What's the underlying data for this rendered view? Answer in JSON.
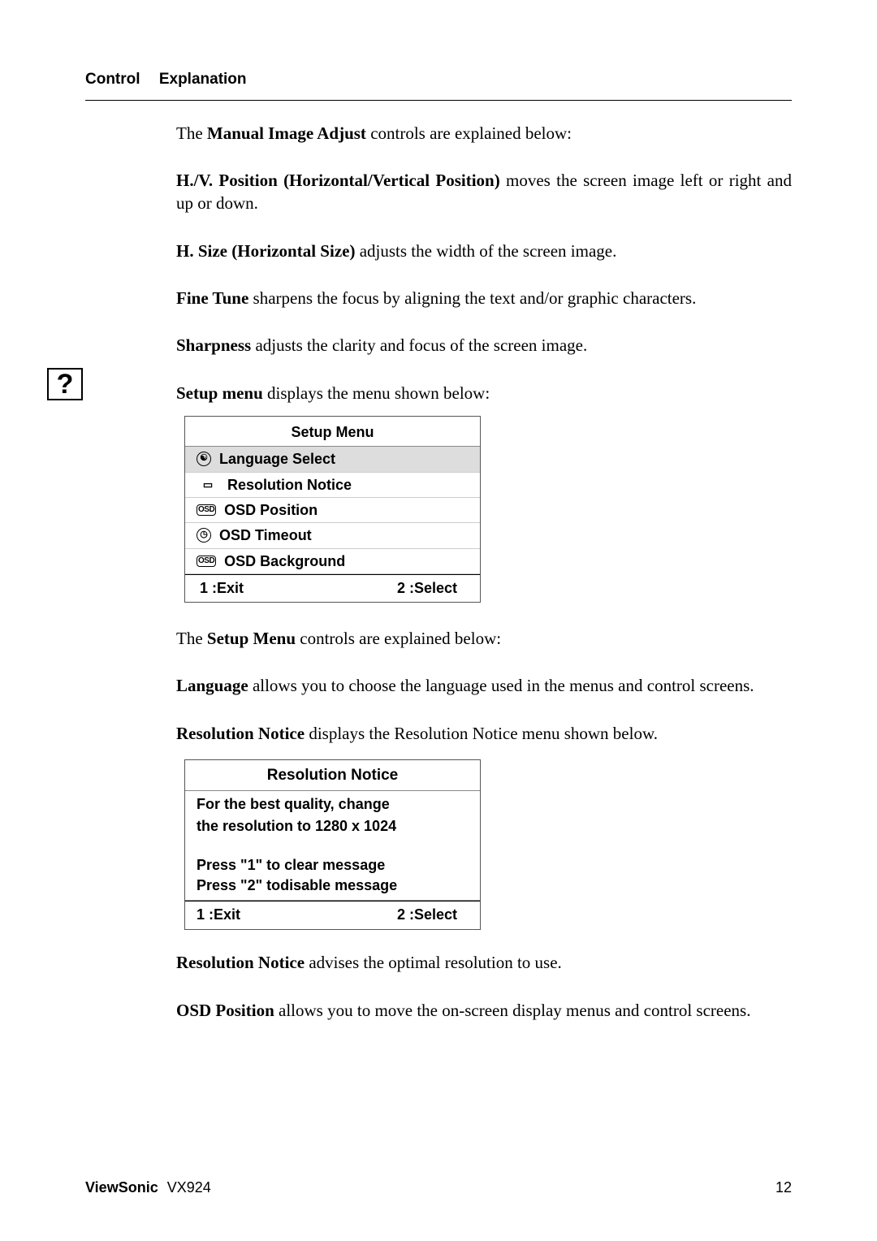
{
  "header": {
    "col1": "Control",
    "col2": "Explanation"
  },
  "paragraphs": {
    "p1_a": "The ",
    "p1_b": "Manual Image Adjust",
    "p1_c": " controls are explained below:",
    "p2_b": "H./V. Position (Horizontal/Vertical Position)",
    "p2_t": " moves the screen image left or right and up or down.",
    "p3_b": "H. Size (Horizontal Size)",
    "p3_t": " adjusts the width of the screen image.",
    "p4_b": "Fine Tune",
    "p4_t": " sharpens the focus by aligning the text and/or graphic characters.",
    "p5_b": "Sharpness",
    "p5_t": " adjusts the clarity and focus of the screen image.",
    "p6_b": "Setup menu",
    "p6_t": " displays the menu shown below:",
    "p7_a": "The ",
    "p7_b": "Setup Menu",
    "p7_c": " controls are explained below:",
    "p8_b": "Language",
    "p8_t": " allows you to choose the language used in the menus and control screens.",
    "p9_b": "Resolution Notice",
    "p9_t": " displays the Resolution Notice menu shown below.",
    "p10_b": "Resolution Notice",
    "p10_t": " advises the optimal resolution to use.",
    "p11_b": "OSD Position",
    "p11_t": " allows you to move the on-screen display menus and control screens."
  },
  "setup_menu": {
    "title": "Setup Menu",
    "items": [
      {
        "icon": "☯",
        "iconClass": "circle",
        "label": "Language Select",
        "selected": true
      },
      {
        "icon": "▭",
        "iconClass": "",
        "label": "Resolution Notice",
        "selected": false
      },
      {
        "icon": "OSD",
        "iconClass": "pill",
        "label": "OSD Position",
        "selected": false
      },
      {
        "icon": "◷",
        "iconClass": "circle",
        "label": "OSD Timeout",
        "selected": false
      },
      {
        "icon": "OSD",
        "iconClass": "pill",
        "label": "OSD Background",
        "selected": false
      }
    ],
    "footer_exit": "1 :Exit",
    "footer_select": "2 :Select"
  },
  "resolution_notice": {
    "title": "Resolution Notice",
    "line1": "For the best quality, change",
    "line2": "the resolution to 1280 x 1024",
    "line3": "Press \"1\" to clear message",
    "line4": "Press \"2\" todisable message",
    "footer_exit": "1 :Exit",
    "footer_select": "2 :Select"
  },
  "footer": {
    "brand": "ViewSonic",
    "model": "VX924",
    "page": "12"
  }
}
